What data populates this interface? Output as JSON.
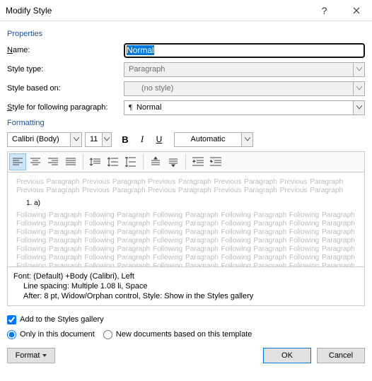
{
  "title": "Modify Style",
  "sections": {
    "properties": "Properties",
    "formatting": "Formatting"
  },
  "labels": {
    "name": "Name:",
    "style_type": "Style type:",
    "style_based": "Style based on:",
    "style_following": "Style for following paragraph:"
  },
  "values": {
    "name": "Normal",
    "style_type": "Paragraph",
    "style_based": "(no style)",
    "style_following": "Normal",
    "font": "Calibri (Body)",
    "size": "11",
    "color": "Automatic"
  },
  "format_chars": {
    "bold": "B",
    "italic": "I",
    "underline": "U"
  },
  "preview": {
    "prev": "Previous Paragraph Previous Paragraph Previous Paragraph Previous Paragraph Previous Paragraph Previous Paragraph Previous Paragraph Previous Paragraph Previous Paragraph Previous Paragraph",
    "sample": "1.          a)",
    "next": "Following Paragraph Following Paragraph Following Paragraph Following Paragraph Following Paragraph Following Paragraph Following Paragraph Following Paragraph Following Paragraph Following Paragraph Following Paragraph Following Paragraph Following Paragraph Following Paragraph Following Paragraph Following Paragraph Following Paragraph Following Paragraph Following Paragraph Following Paragraph Following Paragraph Following Paragraph Following Paragraph Following Paragraph Following Paragraph Following Paragraph Following Paragraph Following Paragraph Following Paragraph Following Paragraph Following Paragraph Following Paragraph Following Paragraph Following Paragraph Following Paragraph"
  },
  "description": {
    "line1": "Font: (Default) +Body (Calibri), Left",
    "line2": "Line spacing:  Multiple 1.08 li, Space",
    "line3": "After:  8 pt, Widow/Orphan control, Style: Show in the Styles gallery"
  },
  "checks": {
    "add_gallery": "Add to the Styles gallery",
    "only_doc": "Only in this document",
    "new_docs": "New documents based on this template"
  },
  "buttons": {
    "format": "Format",
    "ok": "OK",
    "cancel": "Cancel"
  }
}
